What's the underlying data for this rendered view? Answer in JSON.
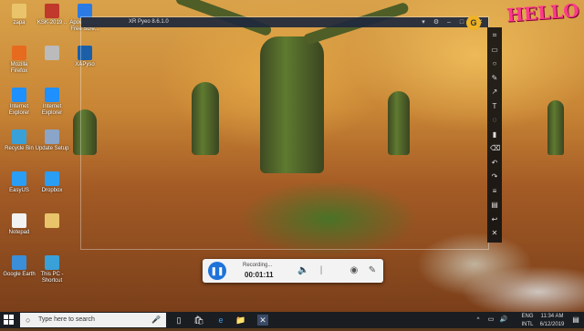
{
  "desktop": {
    "icons": [
      {
        "label": "zapa",
        "color": "#e9c46a"
      },
      {
        "label": "KSK-2019 ..",
        "color": "#c0392b"
      },
      {
        "label": "Apoweresoft Free Scre...",
        "color": "#2c7be5"
      },
      {
        "label": "Mozilla Firefox",
        "color": "#e66b1f"
      },
      {
        "label": "",
        "color": "#bbbbbb"
      },
      {
        "label": "XAPyso",
        "color": "#1b5fa8"
      },
      {
        "label": "Internet Explorer",
        "color": "#1e90ff"
      },
      {
        "label": "Internet Explorer",
        "color": "#1e90ff"
      },
      {
        "label": "Recycle Bin",
        "color": "#3aa0d8"
      },
      {
        "label": "Update Setup",
        "color": "#8aa5c8"
      },
      {
        "label": "EasyUS",
        "color": "#2a9df4"
      },
      {
        "label": "Dropbox",
        "color": "#2a9df4"
      },
      {
        "label": "Notepad",
        "color": "#f2f2f2"
      },
      {
        "label": "",
        "color": "#e9c46a"
      },
      {
        "label": "Google Earth",
        "color": "#3b8ed8"
      },
      {
        "label": "This PC - Shortcut",
        "color": "#3aa0d8"
      }
    ]
  },
  "recorder_window": {
    "title": "XR Pyeo 8.6.1.0",
    "buttons": [
      "close-icon",
      "maximize-icon",
      "minimize-icon",
      "settings-icon"
    ]
  },
  "side_toolbar": {
    "tools": [
      "crop",
      "rectangle",
      "ellipse",
      "pen",
      "arrow",
      "text",
      "blur",
      "highlighter",
      "eraser",
      "undo",
      "redo",
      "menu",
      "save",
      "back",
      "close"
    ]
  },
  "overlay_text": "HELLO",
  "recording_bar": {
    "status": "Recording...",
    "time": "00:01:11"
  },
  "taskbar": {
    "search_placeholder": "Type here to search",
    "tray": {
      "lang": "ENG",
      "layout": "INTL",
      "time": "11:34 AM",
      "date": "6/12/2019"
    }
  },
  "colors": {
    "accent": "#1e73d9",
    "hello": "#ff3a8c",
    "taskbar": "#1a1d22"
  }
}
